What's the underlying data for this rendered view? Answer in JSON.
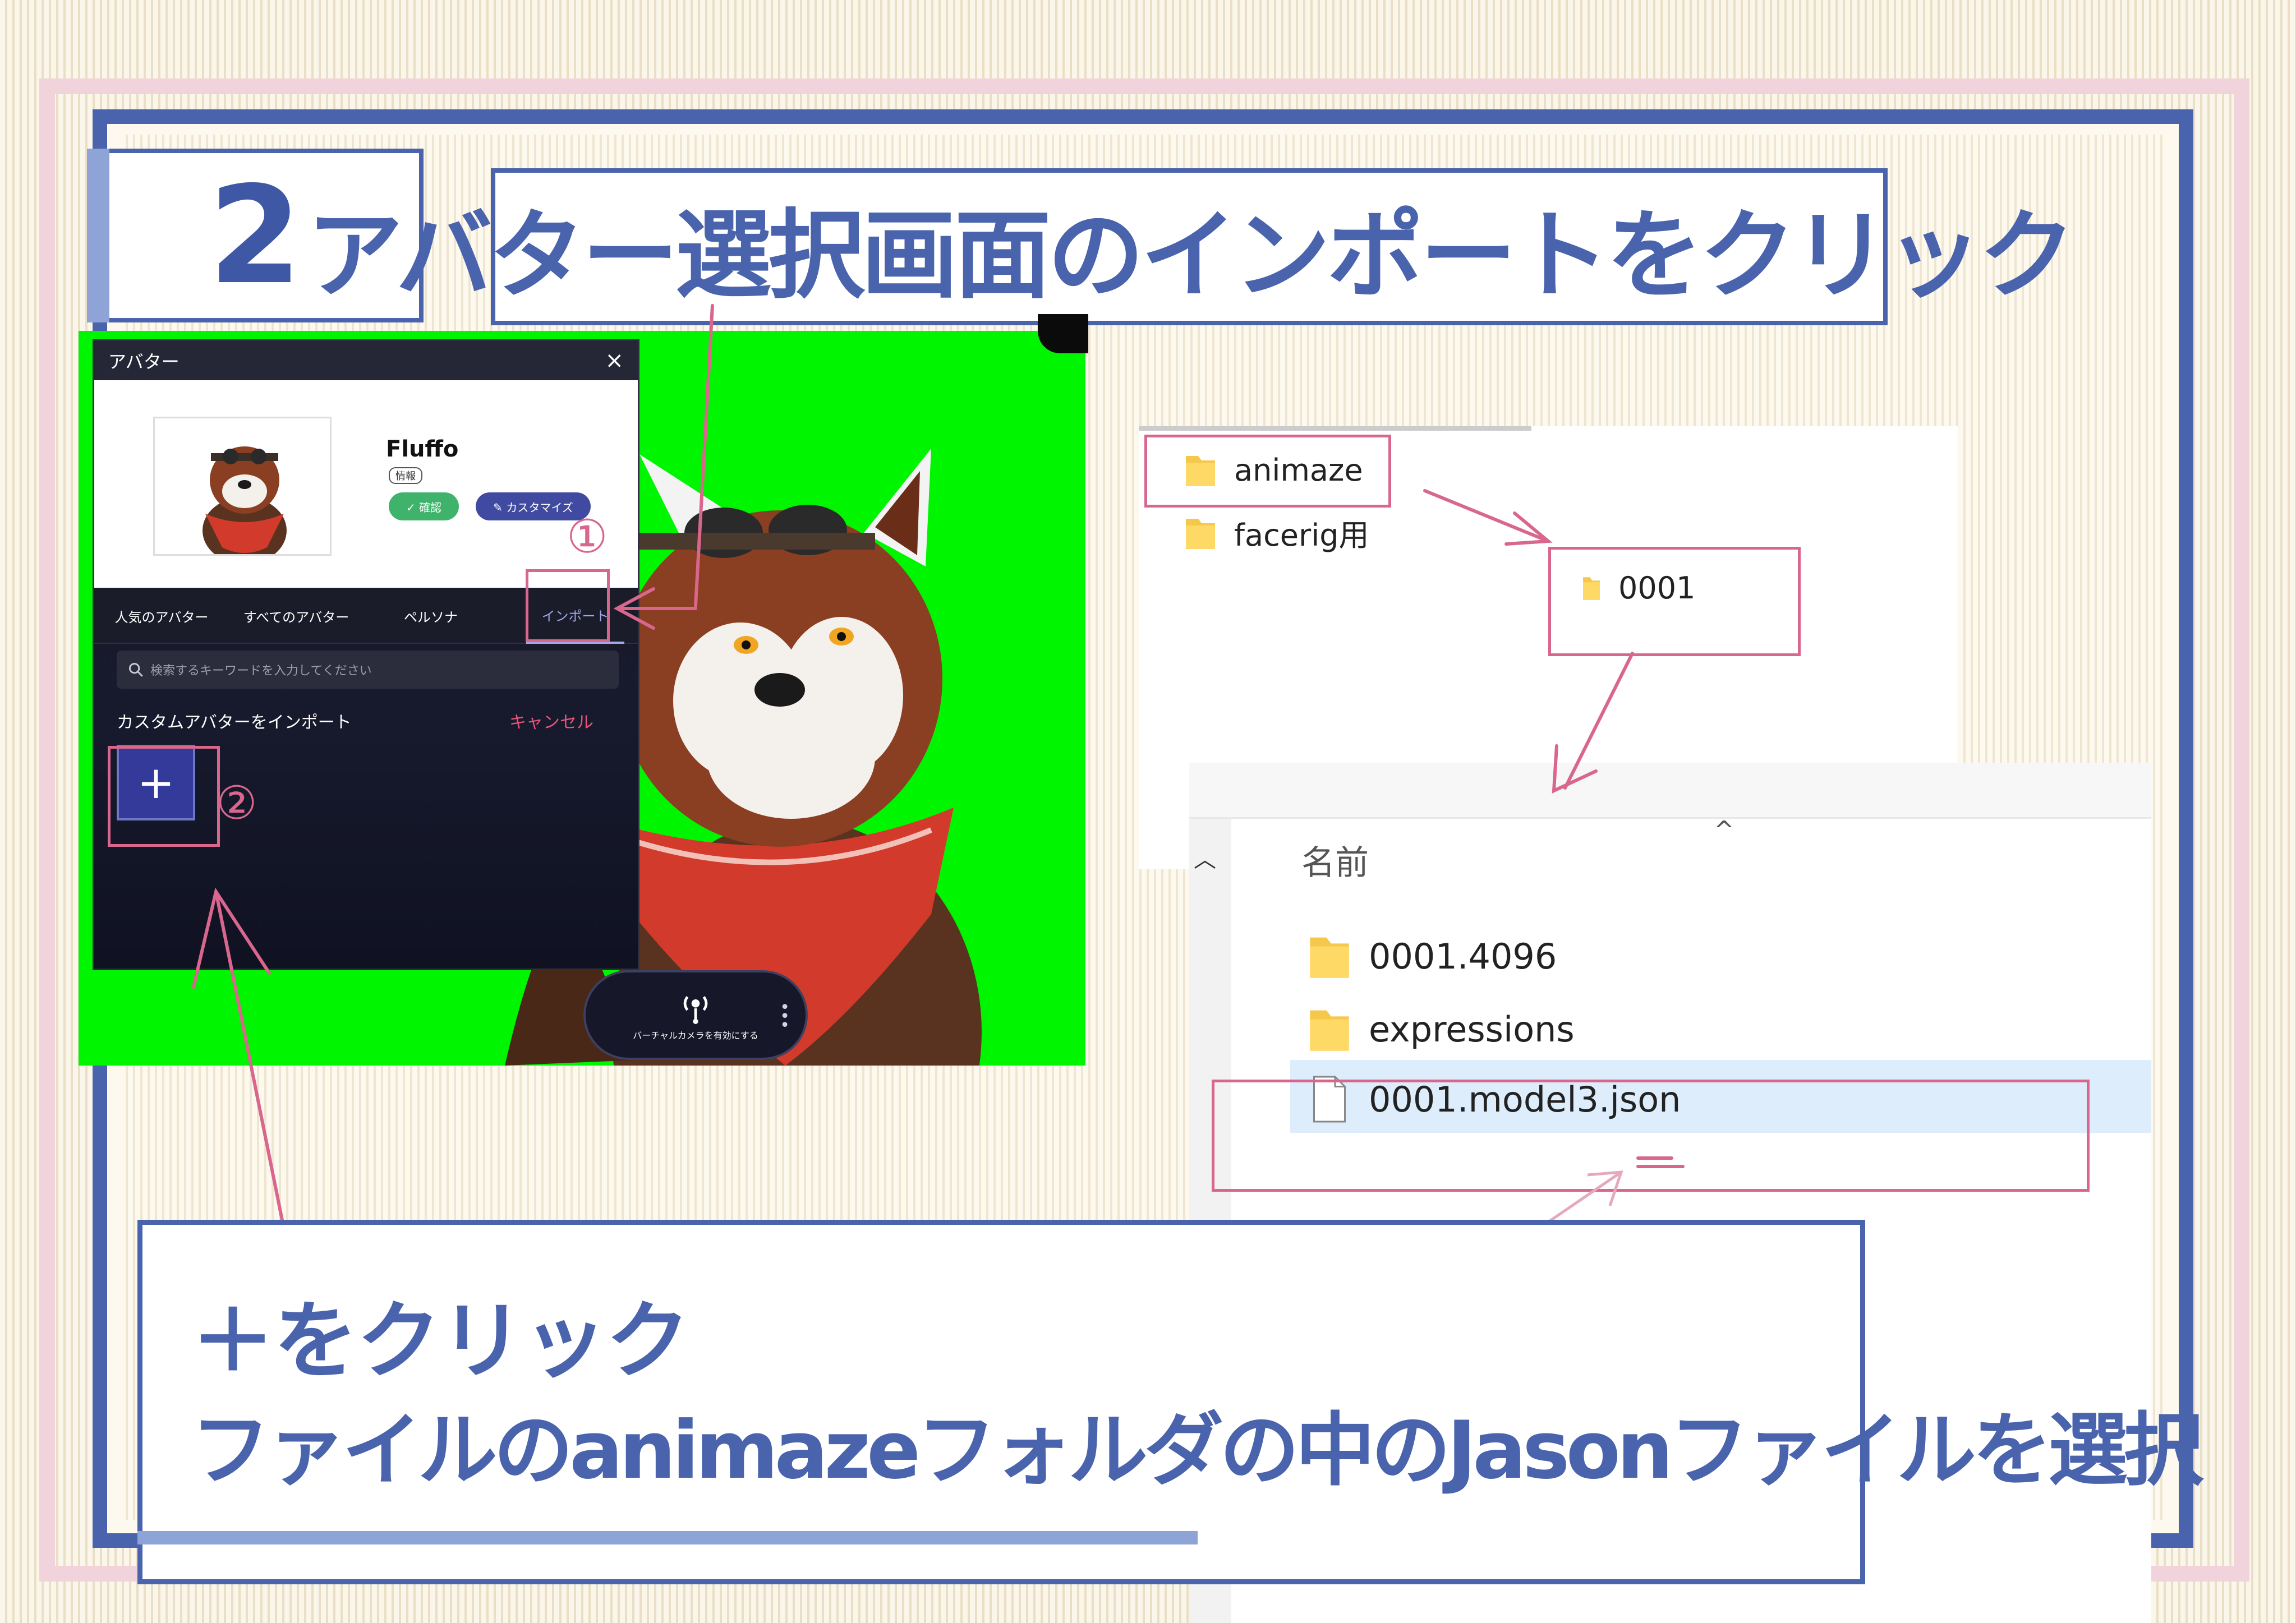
{
  "step": {
    "number": "2",
    "title": "アバター選択画面のインポートをクリック"
  },
  "dialog": {
    "title": "アバター",
    "close_icon": "×",
    "avatar_name": "Fluffo",
    "info_tag": "情報",
    "confirm_label": "✓ 確認",
    "customize_label": "✎ カスタマイズ",
    "tabs": [
      {
        "label": "人気のアバター"
      },
      {
        "label": "すべてのアバター"
      },
      {
        "label": "ペルソナ"
      },
      {
        "label": "インポート"
      }
    ],
    "search_placeholder": "検索するキーワードを入力してください",
    "import_label": "カスタムアバターをインポート",
    "cancel_label": "キャンセル",
    "add_label": "+"
  },
  "virtual_camera": {
    "label": "バーチャルカメラを有効にする"
  },
  "markers": {
    "one": "①",
    "two": "②"
  },
  "explorer_1": {
    "folders": [
      {
        "name": "animaze"
      },
      {
        "name": "facerig用"
      }
    ],
    "subfolder": "0001"
  },
  "explorer_2": {
    "column_header": "名前",
    "sort_caret": "^",
    "items": [
      {
        "name": "0001.4096",
        "type": "folder"
      },
      {
        "name": "expressions",
        "type": "folder"
      },
      {
        "name": "0001.model3.json",
        "type": "file"
      }
    ]
  },
  "instructions": {
    "line1": "＋をクリック",
    "line2": "ファイルのanimazeフォルダの中のJasonファイルを選択"
  },
  "colors": {
    "accent_blue": "#4a63ad",
    "marker_pink": "#d9668c",
    "green_screen": "#00f500"
  }
}
